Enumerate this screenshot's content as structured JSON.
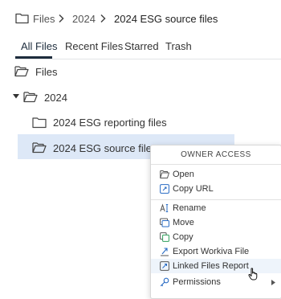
{
  "breadcrumb": {
    "items": [
      "Files",
      "2024",
      "2024 ESG source files"
    ]
  },
  "tabs": [
    {
      "label": "All Files",
      "active": true
    },
    {
      "label": "Recent Files",
      "active": false
    },
    {
      "label": "Starred",
      "active": false
    },
    {
      "label": "Trash",
      "active": false
    }
  ],
  "tree": {
    "items": [
      {
        "label": "Files"
      },
      {
        "label": "2024",
        "expanded": true
      },
      {
        "label": "2024 ESG reporting files"
      },
      {
        "label": "2024 ESG source files",
        "selected": true
      }
    ]
  },
  "context_menu": {
    "header": "OWNER ACCESS",
    "items": [
      {
        "label": "Open",
        "icon": "folder-open-icon"
      },
      {
        "label": "Copy URL",
        "icon": "link-icon"
      },
      {
        "label": "Rename",
        "icon": "rename-icon"
      },
      {
        "label": "Move",
        "icon": "move-icon"
      },
      {
        "label": "Copy",
        "icon": "copy-icon"
      },
      {
        "label": "Export Workiva File",
        "icon": "export-icon"
      },
      {
        "label": "Linked Files Report",
        "icon": "linked-report-icon",
        "hovered": true
      },
      {
        "label": "Permissions",
        "icon": "permissions-key-icon",
        "has_submenu": true
      }
    ]
  },
  "colors": {
    "accent": "#2a6cc4",
    "selection": "#dde8f7",
    "hover": "#eef4fb",
    "tab_underline": "#1e2d3d"
  }
}
